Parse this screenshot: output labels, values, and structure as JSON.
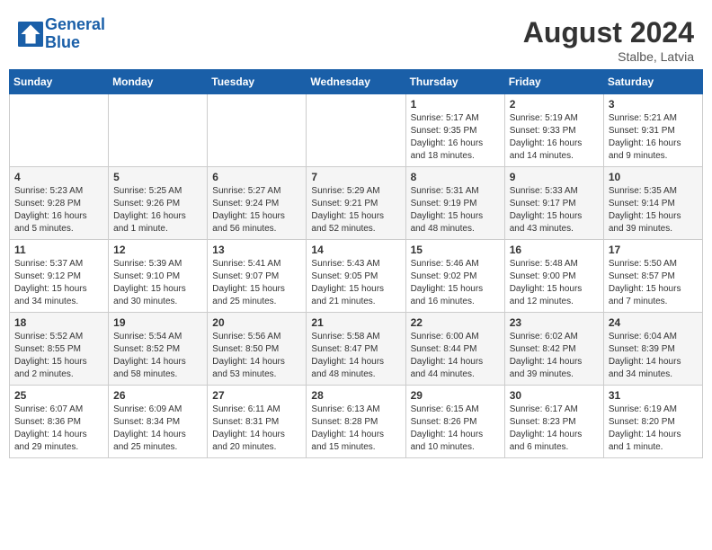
{
  "header": {
    "logo_line1": "General",
    "logo_line2": "Blue",
    "month_year": "August 2024",
    "location": "Stalbe, Latvia"
  },
  "weekdays": [
    "Sunday",
    "Monday",
    "Tuesday",
    "Wednesday",
    "Thursday",
    "Friday",
    "Saturday"
  ],
  "weeks": [
    [
      {
        "day": "",
        "info": ""
      },
      {
        "day": "",
        "info": ""
      },
      {
        "day": "",
        "info": ""
      },
      {
        "day": "",
        "info": ""
      },
      {
        "day": "1",
        "info": "Sunrise: 5:17 AM\nSunset: 9:35 PM\nDaylight: 16 hours\nand 18 minutes."
      },
      {
        "day": "2",
        "info": "Sunrise: 5:19 AM\nSunset: 9:33 PM\nDaylight: 16 hours\nand 14 minutes."
      },
      {
        "day": "3",
        "info": "Sunrise: 5:21 AM\nSunset: 9:31 PM\nDaylight: 16 hours\nand 9 minutes."
      }
    ],
    [
      {
        "day": "4",
        "info": "Sunrise: 5:23 AM\nSunset: 9:28 PM\nDaylight: 16 hours\nand 5 minutes."
      },
      {
        "day": "5",
        "info": "Sunrise: 5:25 AM\nSunset: 9:26 PM\nDaylight: 16 hours\nand 1 minute."
      },
      {
        "day": "6",
        "info": "Sunrise: 5:27 AM\nSunset: 9:24 PM\nDaylight: 15 hours\nand 56 minutes."
      },
      {
        "day": "7",
        "info": "Sunrise: 5:29 AM\nSunset: 9:21 PM\nDaylight: 15 hours\nand 52 minutes."
      },
      {
        "day": "8",
        "info": "Sunrise: 5:31 AM\nSunset: 9:19 PM\nDaylight: 15 hours\nand 48 minutes."
      },
      {
        "day": "9",
        "info": "Sunrise: 5:33 AM\nSunset: 9:17 PM\nDaylight: 15 hours\nand 43 minutes."
      },
      {
        "day": "10",
        "info": "Sunrise: 5:35 AM\nSunset: 9:14 PM\nDaylight: 15 hours\nand 39 minutes."
      }
    ],
    [
      {
        "day": "11",
        "info": "Sunrise: 5:37 AM\nSunset: 9:12 PM\nDaylight: 15 hours\nand 34 minutes."
      },
      {
        "day": "12",
        "info": "Sunrise: 5:39 AM\nSunset: 9:10 PM\nDaylight: 15 hours\nand 30 minutes."
      },
      {
        "day": "13",
        "info": "Sunrise: 5:41 AM\nSunset: 9:07 PM\nDaylight: 15 hours\nand 25 minutes."
      },
      {
        "day": "14",
        "info": "Sunrise: 5:43 AM\nSunset: 9:05 PM\nDaylight: 15 hours\nand 21 minutes."
      },
      {
        "day": "15",
        "info": "Sunrise: 5:46 AM\nSunset: 9:02 PM\nDaylight: 15 hours\nand 16 minutes."
      },
      {
        "day": "16",
        "info": "Sunrise: 5:48 AM\nSunset: 9:00 PM\nDaylight: 15 hours\nand 12 minutes."
      },
      {
        "day": "17",
        "info": "Sunrise: 5:50 AM\nSunset: 8:57 PM\nDaylight: 15 hours\nand 7 minutes."
      }
    ],
    [
      {
        "day": "18",
        "info": "Sunrise: 5:52 AM\nSunset: 8:55 PM\nDaylight: 15 hours\nand 2 minutes."
      },
      {
        "day": "19",
        "info": "Sunrise: 5:54 AM\nSunset: 8:52 PM\nDaylight: 14 hours\nand 58 minutes."
      },
      {
        "day": "20",
        "info": "Sunrise: 5:56 AM\nSunset: 8:50 PM\nDaylight: 14 hours\nand 53 minutes."
      },
      {
        "day": "21",
        "info": "Sunrise: 5:58 AM\nSunset: 8:47 PM\nDaylight: 14 hours\nand 48 minutes."
      },
      {
        "day": "22",
        "info": "Sunrise: 6:00 AM\nSunset: 8:44 PM\nDaylight: 14 hours\nand 44 minutes."
      },
      {
        "day": "23",
        "info": "Sunrise: 6:02 AM\nSunset: 8:42 PM\nDaylight: 14 hours\nand 39 minutes."
      },
      {
        "day": "24",
        "info": "Sunrise: 6:04 AM\nSunset: 8:39 PM\nDaylight: 14 hours\nand 34 minutes."
      }
    ],
    [
      {
        "day": "25",
        "info": "Sunrise: 6:07 AM\nSunset: 8:36 PM\nDaylight: 14 hours\nand 29 minutes."
      },
      {
        "day": "26",
        "info": "Sunrise: 6:09 AM\nSunset: 8:34 PM\nDaylight: 14 hours\nand 25 minutes."
      },
      {
        "day": "27",
        "info": "Sunrise: 6:11 AM\nSunset: 8:31 PM\nDaylight: 14 hours\nand 20 minutes."
      },
      {
        "day": "28",
        "info": "Sunrise: 6:13 AM\nSunset: 8:28 PM\nDaylight: 14 hours\nand 15 minutes."
      },
      {
        "day": "29",
        "info": "Sunrise: 6:15 AM\nSunset: 8:26 PM\nDaylight: 14 hours\nand 10 minutes."
      },
      {
        "day": "30",
        "info": "Sunrise: 6:17 AM\nSunset: 8:23 PM\nDaylight: 14 hours\nand 6 minutes."
      },
      {
        "day": "31",
        "info": "Sunrise: 6:19 AM\nSunset: 8:20 PM\nDaylight: 14 hours\nand 1 minute."
      }
    ]
  ]
}
